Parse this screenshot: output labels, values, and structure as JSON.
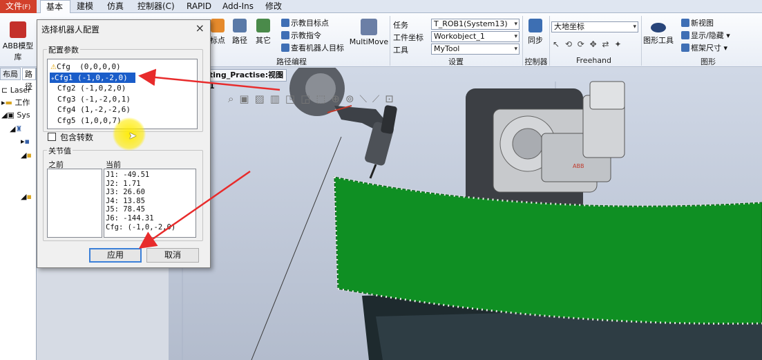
{
  "menubar": {
    "file": "文件",
    "file_accel": "(F)",
    "tabs": [
      "基本",
      "建模",
      "仿真",
      "控制器(C)",
      "RAPID",
      "Add-Ins",
      "修改"
    ]
  },
  "ribbon": {
    "abb_library": "ABB模型库",
    "target_point": "标点",
    "path": "路径",
    "other": "其它",
    "teach_target": "示教目标点",
    "teach_instruction": "示教指令",
    "view_robot_target": "查看机器人目标",
    "multimove": "MultiMove",
    "path_programming": "路径编程",
    "task_label": "任务",
    "task_value": "T_ROB1(System13)",
    "wobj_label": "工件坐标",
    "wobj_value": "Workobject_1",
    "tool_label": "工具",
    "tool_value": "MyTool",
    "settings": "设置",
    "sync": "同步",
    "controller": "控制器",
    "frame_value": "大地坐标",
    "freehand": "Freehand",
    "graphics_tools": "图形工具",
    "new_view": "新视图",
    "show_hide": "显示/隐藏",
    "frame_size": "框架尺寸",
    "graphics": "图形"
  },
  "leftpanel": {
    "tab_layout": "布局",
    "tab_path": "路径",
    "tree": [
      "Laser",
      "工作",
      "Sys"
    ]
  },
  "viewport": {
    "tab_title": "ting_Practise:视图1",
    "tab_close": "×"
  },
  "dialog": {
    "title": "选择机器人配置",
    "close": "×",
    "config_params": "配置参数",
    "configs": [
      "Cfg  (0,0,0,0)",
      "Cfg1 (-1,0,-2,0)",
      "Cfg2 (-1,0,2,0)",
      "Cfg3 (-1,-2,0,1)",
      "Cfg4 (1,-2,-2,6)",
      "Cfg5 (1,0,0,7)"
    ],
    "warn_glyph": "⚠",
    "selected_glyph": "✈",
    "include_turns": "包含转数",
    "joint_values": "关节值",
    "before": "之前",
    "current": "当前",
    "current_values": [
      "J1: -49.51",
      "J2: 1.71",
      "J3: 26.60",
      "J4: 13.85",
      "J5: 78.45",
      "J6: -144.31",
      "Cfg: (-1,0,-2,0)"
    ],
    "apply": "应用",
    "cancel": "取消"
  }
}
